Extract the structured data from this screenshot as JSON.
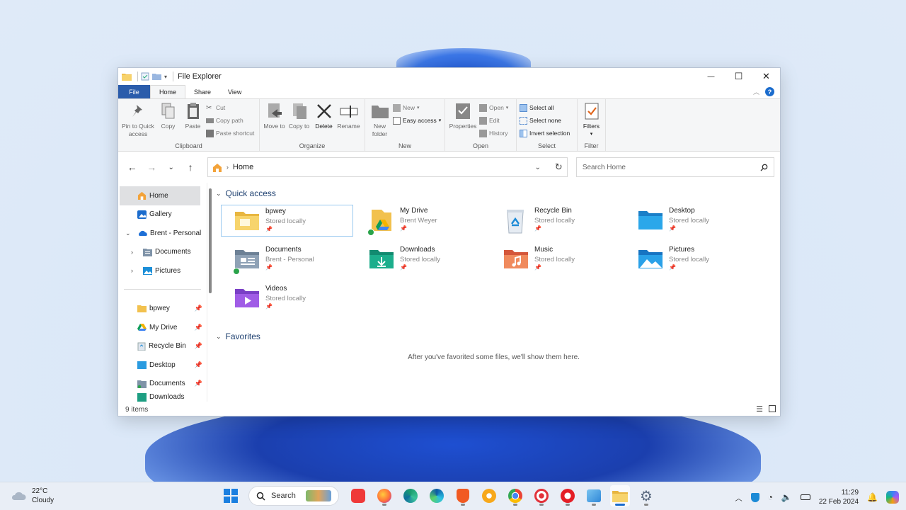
{
  "window": {
    "title": "File Explorer",
    "controls": {
      "minimize": "—",
      "maximize": "☐",
      "close": "✕"
    }
  },
  "ribbon": {
    "tabs": [
      "File",
      "Home",
      "Share",
      "View"
    ],
    "active_tab": "Home",
    "groups": {
      "clipboard": {
        "label": "Clipboard",
        "pin": "Pin to Quick access",
        "copy": "Copy",
        "paste": "Paste",
        "cut": "Cut",
        "copy_path": "Copy path",
        "paste_shortcut": "Paste shortcut"
      },
      "organize": {
        "label": "Organize",
        "move_to": "Move to",
        "copy_to": "Copy to",
        "delete": "Delete",
        "rename": "Rename"
      },
      "new": {
        "label": "New",
        "new_folder": "New folder",
        "new_item": "New",
        "easy_access": "Easy access"
      },
      "open": {
        "label": "Open",
        "properties": "Properties",
        "open": "Open",
        "edit": "Edit",
        "history": "History"
      },
      "select": {
        "label": "Select",
        "select_all": "Select all",
        "select_none": "Select none",
        "invert": "Invert selection"
      },
      "filter": {
        "label": "Filter",
        "filters": "Filters"
      }
    }
  },
  "address": {
    "path": "Home"
  },
  "search": {
    "placeholder": "Search Home"
  },
  "nav": {
    "top": [
      {
        "label": "Home",
        "icon": "home-icon"
      },
      {
        "label": "Gallery",
        "icon": "gallery-icon"
      },
      {
        "label": "Brent - Personal",
        "icon": "onedrive-icon"
      },
      {
        "label": "Documents",
        "icon": "documents-icon"
      },
      {
        "label": "Pictures",
        "icon": "pictures-icon"
      }
    ],
    "pinned": [
      {
        "label": "bpwey"
      },
      {
        "label": "My Drive"
      },
      {
        "label": "Recycle Bin"
      },
      {
        "label": "Desktop"
      },
      {
        "label": "Documents"
      },
      {
        "label": "Downloads"
      }
    ]
  },
  "quick_access": {
    "heading": "Quick access",
    "items": [
      {
        "name": "bpwey",
        "sub": "Stored locally",
        "icon": "folder-icon"
      },
      {
        "name": "My Drive",
        "sub": "Brent Weyer",
        "icon": "google-drive-icon"
      },
      {
        "name": "Recycle Bin",
        "sub": "Stored locally",
        "icon": "recycle-bin-icon"
      },
      {
        "name": "Desktop",
        "sub": "Stored locally",
        "icon": "desktop-folder-icon"
      },
      {
        "name": "Documents",
        "sub": "Brent - Personal",
        "icon": "documents-folder-icon"
      },
      {
        "name": "Downloads",
        "sub": "Stored locally",
        "icon": "downloads-folder-icon"
      },
      {
        "name": "Music",
        "sub": "Stored locally",
        "icon": "music-folder-icon"
      },
      {
        "name": "Pictures",
        "sub": "Stored locally",
        "icon": "pictures-folder-icon"
      },
      {
        "name": "Videos",
        "sub": "Stored locally",
        "icon": "videos-folder-icon"
      }
    ]
  },
  "favorites": {
    "heading": "Favorites",
    "empty_message": "After you've favorited some files, we'll show them here."
  },
  "status": {
    "items": "9 items"
  },
  "taskbar": {
    "weather": {
      "temp": "22°C",
      "cond": "Cloudy"
    },
    "search_label": "Search",
    "time": "11:29",
    "date": "22 Feb 2024"
  },
  "colors": {
    "accent": "#1b6ccd",
    "file_tab": "#2a5cab",
    "folder": "#f2c14e"
  }
}
